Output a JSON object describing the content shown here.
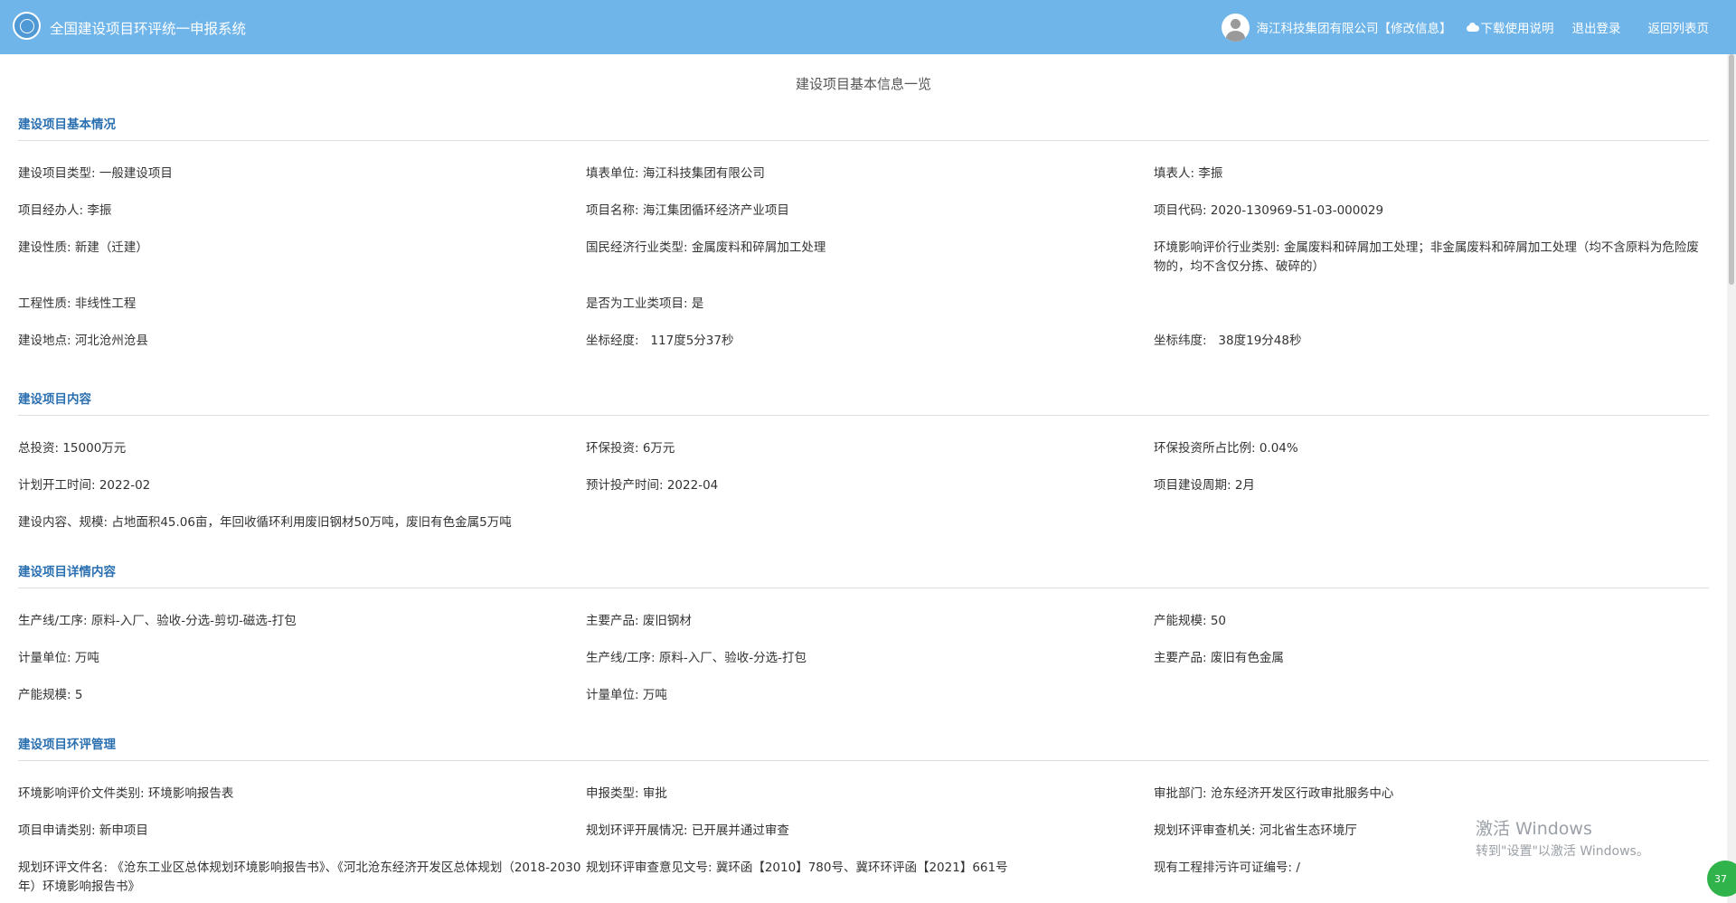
{
  "header": {
    "app_title": "全国建设项目环评统一申报系统",
    "company": "海江科技集团有限公司",
    "edit_info": "【修改信息】",
    "download_manual": "下载使用说明",
    "logout": "退出登录",
    "back_to_list": "返回列表页"
  },
  "page_title": "建设项目基本信息一览",
  "sections": {
    "basic": {
      "title": "建设项目基本情况",
      "rows": [
        [
          "建设项目类型: 一般建设项目",
          "填表单位: 海江科技集团有限公司",
          "填表人: 李振"
        ],
        [
          "项目经办人: 李振",
          "项目名称: 海江集团循环经济产业项目",
          "项目代码: 2020-130969-51-03-000029"
        ],
        [
          "建设性质: 新建（迁建）",
          "国民经济行业类型: 金属废料和碎屑加工处理",
          "环境影响评价行业类别: 金属废料和碎屑加工处理；非金属废料和碎屑加工处理（均不含原料为危险废物的，均不含仅分拣、破碎的）"
        ],
        [
          "工程性质: 非线性工程",
          "是否为工业类项目: 是",
          ""
        ],
        [
          "建设地点: 河北沧州沧县",
          "坐标经度:   117度5分37秒",
          "坐标纬度:   38度19分48秒"
        ]
      ]
    },
    "content": {
      "title": "建设项目内容",
      "rows": [
        [
          "总投资: 15000万元",
          "环保投资: 6万元",
          "环保投资所占比例: 0.04%"
        ],
        [
          "计划开工时间: 2022-02",
          "预计投产时间: 2022-04",
          "项目建设周期: 2月"
        ]
      ],
      "scale": "建设内容、规模: 占地面积45.06亩，年回收循环利用废旧钢材50万吨，废旧有色金属5万吨"
    },
    "details": {
      "title": "建设项目详情内容",
      "rows": [
        [
          "生产线/工序: 原料-入厂、验收-分选-剪切-磁选-打包",
          "主要产品: 废旧钢材",
          "产能规模: 50"
        ],
        [
          "计量单位: 万吨",
          "生产线/工序: 原料-入厂、验收-分选-打包",
          "主要产品: 废旧有色金属"
        ],
        [
          "产能规模: 5",
          "计量单位: 万吨",
          ""
        ]
      ]
    },
    "eia": {
      "title": "建设项目环评管理",
      "rows": [
        [
          "环境影响评价文件类别: 环境影响报告表",
          "申报类型: 审批",
          "审批部门: 沧东经济开发区行政审批服务中心"
        ],
        [
          "项目申请类别: 新申项目",
          "规划环评开展情况: 已开展并通过审查",
          "规划环评审查机关: 河北省生态环境厅"
        ],
        [
          "规划环评文件名: 《沧东工业区总体规划环境影响报告书》、《河北沧东经济开发区总体规划（2018-2030年）环境影响报告书》",
          "规划环评审查意见文号: 冀环函【2010】780号、冀环环评函【2021】661号",
          "现有工程排污许可证编号: /"
        ]
      ]
    }
  },
  "watermark": {
    "line1": "激活 Windows",
    "line2": "转到\"设置\"以激活 Windows。"
  },
  "badge": "37"
}
